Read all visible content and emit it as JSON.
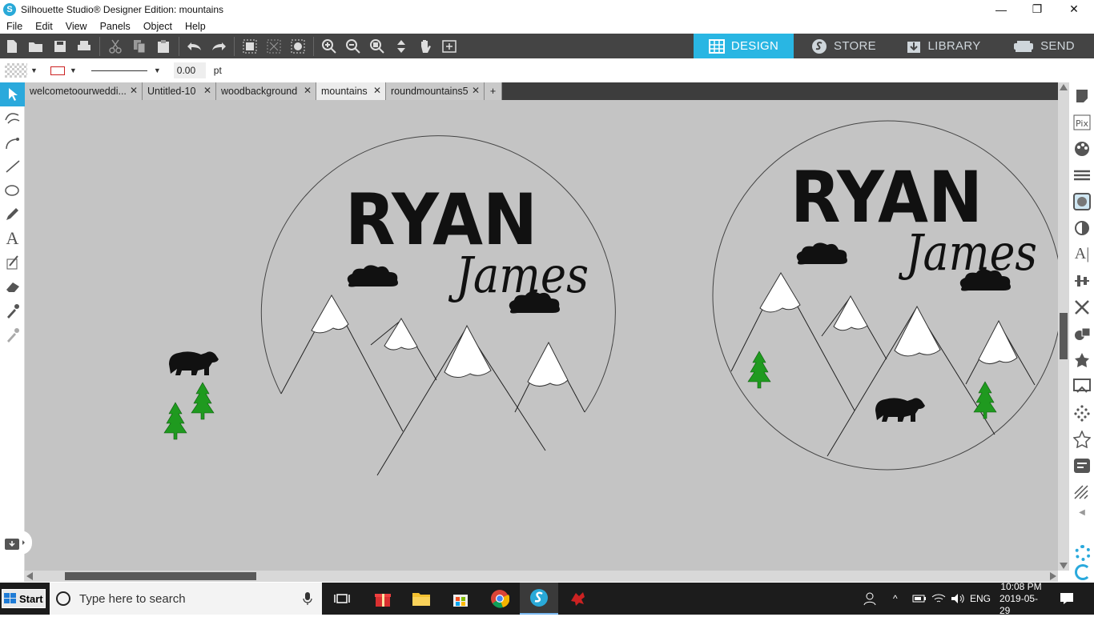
{
  "window": {
    "title": "Silhouette Studio® Designer Edition: mountains",
    "logo_letter": "S",
    "minimize": "—",
    "maximize": "❐",
    "close": "✕"
  },
  "menu": [
    "File",
    "Edit",
    "View",
    "Panels",
    "Object",
    "Help"
  ],
  "mode_tabs": [
    {
      "label": "DESIGN",
      "icon": "grid-icon",
      "active": true
    },
    {
      "label": "STORE",
      "icon": "silhouette-s-icon",
      "active": false
    },
    {
      "label": "LIBRARY",
      "icon": "download-folder-icon",
      "active": false
    },
    {
      "label": "SEND",
      "icon": "cutter-icon",
      "active": false
    }
  ],
  "properties": {
    "line_width": "0.00",
    "unit": "pt"
  },
  "doc_tabs": [
    {
      "label": "welcometoourweddi...",
      "active": false
    },
    {
      "label": "Untitled-10",
      "active": false
    },
    {
      "label": "woodbackground",
      "active": false
    },
    {
      "label": "mountains",
      "active": true
    },
    {
      "label": "roundmountains5",
      "active": false
    }
  ],
  "add_tab": "+",
  "design": {
    "name_line1": "RYAN",
    "name_line2": "James"
  },
  "taskbar": {
    "start": "Start",
    "search_placeholder": "Type here to search",
    "language": "ENG",
    "time": "10:08 PM",
    "date": "2019-05-29"
  },
  "colors": {
    "accent": "#29b6e3",
    "canvas": "#c4c4c4",
    "tree": "#1f9a1f",
    "toolbar": "#444444"
  }
}
